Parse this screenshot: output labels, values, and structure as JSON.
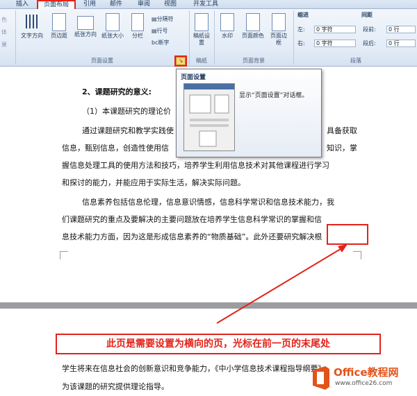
{
  "ribbon_tabs": [
    "插入",
    "页面布局",
    "引用",
    "邮件",
    "审阅",
    "视图",
    "开发工具"
  ],
  "left_partial": [
    "色",
    "体",
    "果"
  ],
  "page_setup": {
    "buttons": [
      "文字方向",
      "页边距",
      "纸张方向",
      "纸张大小",
      "分栏"
    ],
    "small_buttons": [
      "分隔符",
      "行号",
      "断字"
    ],
    "label": "页面设置"
  },
  "paper_group": {
    "button": "稿纸设置",
    "label": "稿纸"
  },
  "background_group": {
    "buttons": [
      "水印",
      "页面颜色",
      "页面边框"
    ],
    "label": "页面背景"
  },
  "paragraph_group": {
    "indent_label": "缩进",
    "left_label": "左:",
    "left_value": "0 字符",
    "right_label": "右:",
    "right_value": "0 字符",
    "spacing_label": "间距",
    "before_label": "段前:",
    "before_value": "0 行",
    "after_label": "段后:",
    "after_value": "0 行",
    "label": "段落"
  },
  "tooltip": {
    "title": "页面设置",
    "description": "显示“页面设置”对话框。"
  },
  "document": {
    "heading": "2、课题研究的意义:",
    "subheading": "（1）本课题研究的理论价",
    "para1": [
      "通过课题研究和教学实践使",
      "信息，甄别信息，创造性使用信",
      "握信息处理工具的使用方法和技巧，培养学生利用信息技术对其他课程进行学习",
      "和探讨的能力，并能应用于实际生活，解决实际问题。"
    ],
    "para1_right": [
      "具备获取",
      "知识，掌"
    ],
    "para2": [
      "信息素养包括信息伦理，信息意识情感，信息科学常识和信息技术能力，我",
      "们课题研究的重点及要解决的主要问题放在培养学生信息科学常识的掌握和信",
      "息技术能力方面，因为这是形成信息素养的“物质基础”。此外还要研究解决根"
    ],
    "page2": [
      "学生将来在信息社会的创新意识和竞争能力，《中小学信息技术课程指导纲要》",
      "为该课题的研究提供理论指导。"
    ]
  },
  "annotation": "此页是需要设置为横向的页，光标在前一页的末尾处",
  "watermark": {
    "brand": "Office教程网",
    "url": "www.office26.com"
  },
  "colors": {
    "red": "#e2231a",
    "ribbon_blue": "#1e395b"
  }
}
